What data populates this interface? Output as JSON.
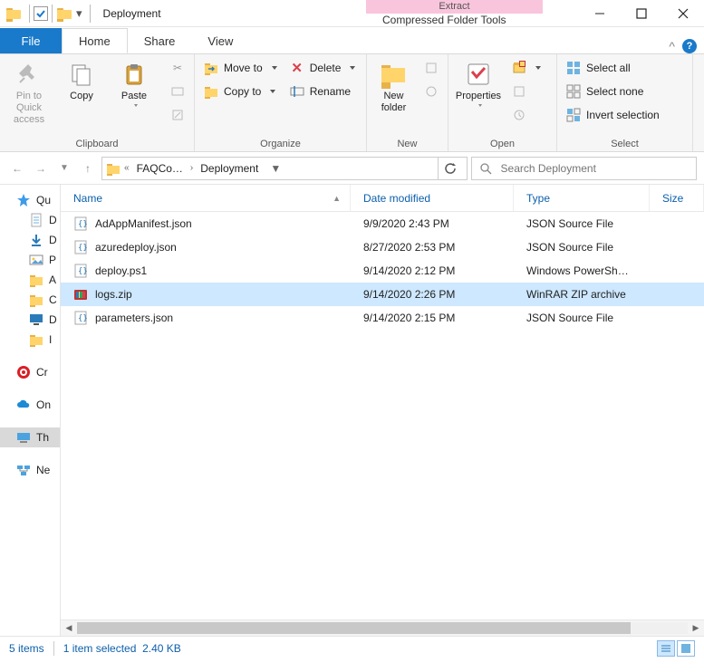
{
  "window": {
    "folder_title": "Deployment",
    "context_header": "Extract",
    "context_tab": "Compressed Folder Tools"
  },
  "tabs": {
    "file": "File",
    "home": "Home",
    "share": "Share",
    "view": "View"
  },
  "ribbon": {
    "clipboard": {
      "label": "Clipboard",
      "pin": "Pin to Quick access",
      "copy": "Copy",
      "paste": "Paste"
    },
    "organize": {
      "label": "Organize",
      "move_to": "Move to",
      "copy_to": "Copy to",
      "delete": "Delete",
      "rename": "Rename"
    },
    "new": {
      "label": "New",
      "new_folder": "New folder"
    },
    "open": {
      "label": "Open",
      "properties": "Properties"
    },
    "select": {
      "label": "Select",
      "select_all": "Select all",
      "select_none": "Select none",
      "invert": "Invert selection"
    }
  },
  "address": {
    "crumb1": "FAQCo…",
    "crumb2": "Deployment"
  },
  "search": {
    "placeholder": "Search Deployment"
  },
  "columns": {
    "name": "Name",
    "date": "Date modified",
    "type": "Type",
    "size": "Size"
  },
  "files": [
    {
      "name": "AdAppManifest.json",
      "date": "9/9/2020 2:43 PM",
      "type": "JSON Source File",
      "icon": "json",
      "selected": false
    },
    {
      "name": "azuredeploy.json",
      "date": "8/27/2020 2:53 PM",
      "type": "JSON Source File",
      "icon": "json",
      "selected": false
    },
    {
      "name": "deploy.ps1",
      "date": "9/14/2020 2:12 PM",
      "type": "Windows PowerSh…",
      "icon": "ps1",
      "selected": false
    },
    {
      "name": "logs.zip",
      "date": "9/14/2020 2:26 PM",
      "type": "WinRAR ZIP archive",
      "icon": "zip",
      "selected": true
    },
    {
      "name": "parameters.json",
      "date": "9/14/2020 2:15 PM",
      "type": "JSON Source File",
      "icon": "json",
      "selected": false
    }
  ],
  "sidebar": [
    {
      "label": "Qu",
      "icon": "star",
      "selected": false
    },
    {
      "label": "D",
      "icon": "doc",
      "selected": false,
      "indent": true
    },
    {
      "label": "D",
      "icon": "down",
      "selected": false,
      "indent": true
    },
    {
      "label": "P",
      "icon": "pic",
      "selected": false,
      "indent": true
    },
    {
      "label": "A",
      "icon": "folder",
      "selected": false,
      "indent": true
    },
    {
      "label": "C",
      "icon": "folder",
      "selected": false,
      "indent": true
    },
    {
      "label": "D",
      "icon": "monitor",
      "selected": false,
      "indent": true
    },
    {
      "label": "I",
      "icon": "folder",
      "selected": false,
      "indent": true
    },
    {
      "label": "Cr",
      "icon": "cc",
      "selected": false
    },
    {
      "label": "On",
      "icon": "cloud",
      "selected": false
    },
    {
      "label": "Th",
      "icon": "pc",
      "selected": true
    },
    {
      "label": "Ne",
      "icon": "net",
      "selected": false
    }
  ],
  "status": {
    "count": "5 items",
    "selection": "1 item selected",
    "size": "2.40 KB"
  }
}
